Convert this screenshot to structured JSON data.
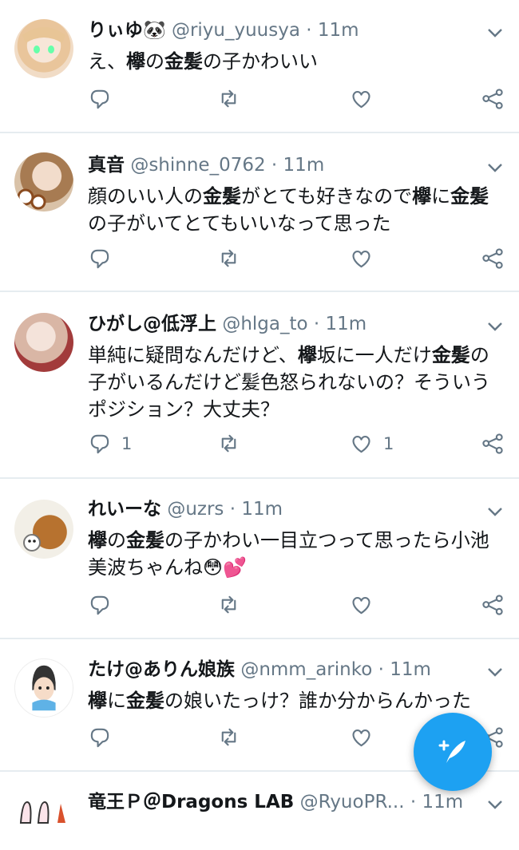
{
  "tweets": [
    {
      "name": "りぃゆ🐼",
      "handle": "@riyu_yuusya",
      "dot": "·",
      "time": "11m",
      "text": [
        {
          "t": "え、"
        },
        {
          "t": "欅",
          "b": true
        },
        {
          "t": "の"
        },
        {
          "t": "金髪",
          "b": true
        },
        {
          "t": "の子かわいい"
        }
      ],
      "replies": "",
      "likes": ""
    },
    {
      "name": "真音",
      "handle": "@shinne_0762",
      "dot": "·",
      "time": "11m",
      "text": [
        {
          "t": "顔のいい人の"
        },
        {
          "t": "金髪",
          "b": true
        },
        {
          "t": "がとても好きなので"
        },
        {
          "t": "欅",
          "b": true
        },
        {
          "t": "に"
        },
        {
          "t": "金髪",
          "b": true
        },
        {
          "t": "の子がいてとてもいいなって思った"
        }
      ],
      "replies": "",
      "likes": ""
    },
    {
      "name": "ひがし@低浮上",
      "handle": "@hlga_to",
      "dot": "·",
      "time": "11m",
      "text": [
        {
          "t": "単純に疑問なんだけど、"
        },
        {
          "t": "欅",
          "b": true
        },
        {
          "t": "坂に一人だけ"
        },
        {
          "t": "金髪",
          "b": true
        },
        {
          "t": "の子がいるんだけど髪色怒られないの？そういうポジション？大丈夫？"
        }
      ],
      "replies": "1",
      "likes": "1"
    },
    {
      "name": "れいーな",
      "handle": "@uzrs",
      "dot": "·",
      "time": "11m",
      "text": [
        {
          "t": "欅",
          "b": true
        },
        {
          "t": "の"
        },
        {
          "t": "金髪",
          "b": true
        },
        {
          "t": "の子かわい一目立つって思ったら小池美波ちゃんね😳💕"
        }
      ],
      "replies": "",
      "likes": ""
    },
    {
      "name": "たけ@ありん娘族",
      "handle": "@nmm_arinko",
      "dot": "·",
      "time": "11m",
      "text": [
        {
          "t": "欅",
          "b": true
        },
        {
          "t": "に"
        },
        {
          "t": "金髪",
          "b": true
        },
        {
          "t": "の娘いたっけ？誰か分からんかった"
        }
      ],
      "replies": "",
      "likes": ""
    },
    {
      "name": "竜王Ｐ＠Dragons LAB",
      "handle": "@RyuoPR...",
      "dot": "·",
      "time": "11m",
      "text": [],
      "replies": "",
      "likes": ""
    }
  ],
  "icons": [
    "reply-icon",
    "retweet-icon",
    "like-icon",
    "share-icon",
    "chevron-down-icon",
    "compose-icon"
  ],
  "colors": {
    "accent": "#1da1f2",
    "secondary_text": "#657786",
    "divider": "#e6ecf0"
  }
}
